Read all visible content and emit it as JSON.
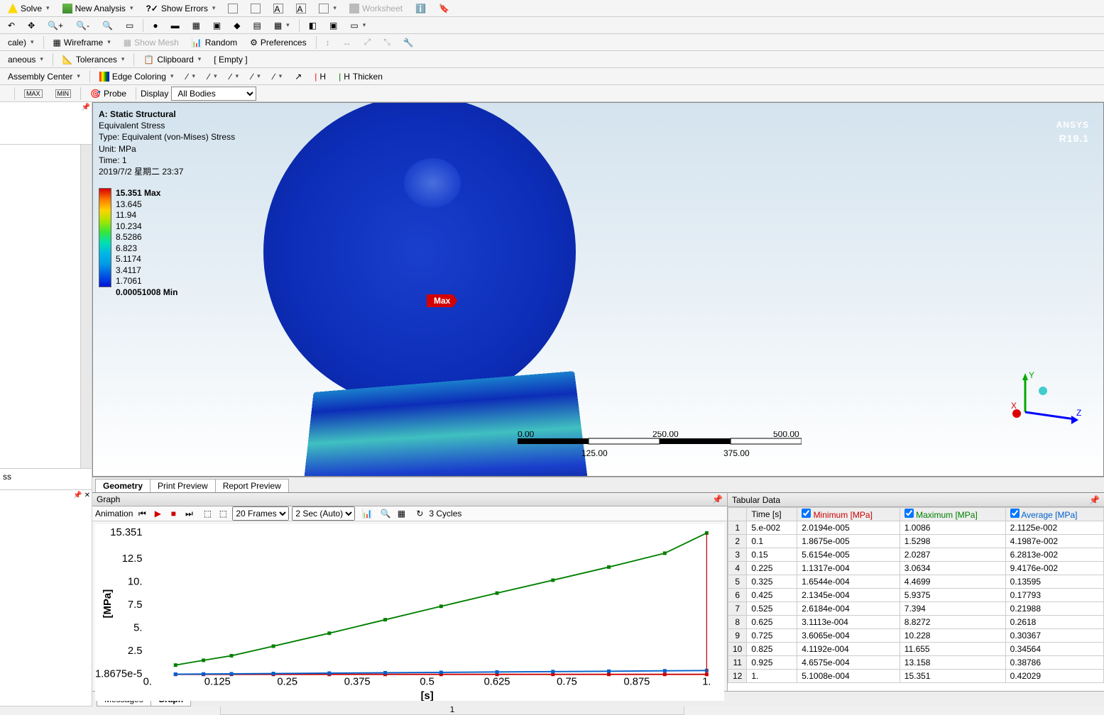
{
  "toolbars": {
    "row1": {
      "solve": "Solve",
      "new_analysis": "New Analysis",
      "show_errors": "Show Errors",
      "worksheet": "Worksheet"
    },
    "row2": {
      "scale": "cale)",
      "wireframe": "Wireframe",
      "show_mesh": "Show Mesh",
      "random": "Random",
      "preferences": "Preferences"
    },
    "row3": {
      "aneous": "aneous",
      "tolerances": "Tolerances",
      "clipboard": "Clipboard",
      "empty": "[ Empty ]"
    },
    "row4": {
      "assembly_center": "Assembly Center",
      "edge_coloring": "Edge Coloring",
      "thicken": "Thicken"
    },
    "row5": {
      "probe": "Probe",
      "display": "Display",
      "all_bodies": "All Bodies"
    }
  },
  "viewport": {
    "title": "A: Static Structural",
    "subtitle1": "Equivalent Stress",
    "subtitle2": "Type: Equivalent (von-Mises) Stress",
    "unit": "Unit: MPa",
    "time": "Time: 1",
    "timestamp": "2019/7/2 星期二 23:37",
    "legend": [
      "15.351 Max",
      "13.645",
      "11.94",
      "10.234",
      "8.5286",
      "6.823",
      "5.1174",
      "3.4117",
      "1.7061",
      "0.00051008 Min"
    ],
    "max_tag": "Max",
    "scale": {
      "v0": "0.00",
      "v1": "125.00",
      "v2": "250.00",
      "v3": "375.00",
      "v4": "500.00 (mm)"
    },
    "brand": "ANSYS",
    "version": "R19.1",
    "axes": {
      "x": "X",
      "y": "Y",
      "z": "Z"
    }
  },
  "view_tabs": {
    "geometry": "Geometry",
    "print": "Print Preview",
    "report": "Report Preview"
  },
  "graph_panel": {
    "title": "Graph",
    "animation": "Animation",
    "frames": "20 Frames",
    "duration": "2 Sec (Auto)",
    "cycles": "3 Cycles",
    "ylabel": "[MPa]",
    "xlabel": "[s]",
    "scrollpos": "1"
  },
  "tabular_panel": {
    "title": "Tabular Data",
    "headers": {
      "time": "Time [s]",
      "min": "Minimum [MPa]",
      "max": "Maximum [MPa]",
      "avg": "Average [MPa]"
    },
    "rows": [
      {
        "n": "1",
        "time": "5.e-002",
        "min": "2.0194e-005",
        "max": "1.0086",
        "avg": "2.1125e-002"
      },
      {
        "n": "2",
        "time": "0.1",
        "min": "1.8675e-005",
        "max": "1.5298",
        "avg": "4.1987e-002"
      },
      {
        "n": "3",
        "time": "0.15",
        "min": "5.6154e-005",
        "max": "2.0287",
        "avg": "6.2813e-002"
      },
      {
        "n": "4",
        "time": "0.225",
        "min": "1.1317e-004",
        "max": "3.0634",
        "avg": "9.4176e-002"
      },
      {
        "n": "5",
        "time": "0.325",
        "min": "1.6544e-004",
        "max": "4.4699",
        "avg": "0.13595"
      },
      {
        "n": "6",
        "time": "0.425",
        "min": "2.1345e-004",
        "max": "5.9375",
        "avg": "0.17793"
      },
      {
        "n": "7",
        "time": "0.525",
        "min": "2.6184e-004",
        "max": "7.394",
        "avg": "0.21988"
      },
      {
        "n": "8",
        "time": "0.625",
        "min": "3.1113e-004",
        "max": "8.8272",
        "avg": "0.2618"
      },
      {
        "n": "9",
        "time": "0.725",
        "min": "3.6065e-004",
        "max": "10.228",
        "avg": "0.30367"
      },
      {
        "n": "10",
        "time": "0.825",
        "min": "4.1192e-004",
        "max": "11.655",
        "avg": "0.34564"
      },
      {
        "n": "11",
        "time": "0.925",
        "min": "4.6575e-004",
        "max": "13.158",
        "avg": "0.38786"
      },
      {
        "n": "12",
        "time": "1.",
        "min": "5.1008e-004",
        "max": "15.351",
        "avg": "0.42029"
      }
    ]
  },
  "bottom_tabs": {
    "messages": "Messages",
    "graph": "Graph"
  },
  "chart_data": {
    "type": "line",
    "title": "",
    "xlabel": "[s]",
    "ylabel": "[MPa]",
    "xlim": [
      0,
      1
    ],
    "ylim": [
      1.8675e-05,
      15.351
    ],
    "x_ticks": [
      "0.",
      "0.125",
      "0.25",
      "0.375",
      "0.5",
      "0.625",
      "0.75",
      "0.875",
      "1."
    ],
    "y_ticks": [
      "1.8675e-5",
      "2.5",
      "5.",
      "7.5",
      "10.",
      "12.5",
      "15.351"
    ],
    "x": [
      0.05,
      0.1,
      0.15,
      0.225,
      0.325,
      0.425,
      0.525,
      0.625,
      0.725,
      0.825,
      0.925,
      1.0
    ],
    "series": [
      {
        "name": "Minimum",
        "color": "#cc0000",
        "values": [
          2.0194e-05,
          1.8675e-05,
          5.6154e-05,
          0.00011317,
          0.00016544,
          0.00021345,
          0.00026184,
          0.00031113,
          0.00036065,
          0.00041192,
          0.00046575,
          0.00051008
        ]
      },
      {
        "name": "Maximum",
        "color": "#008000",
        "values": [
          1.0086,
          1.5298,
          2.0287,
          3.0634,
          4.4699,
          5.9375,
          7.394,
          8.8272,
          10.228,
          11.655,
          13.158,
          15.351
        ]
      },
      {
        "name": "Average",
        "color": "#0060cc",
        "values": [
          0.021125,
          0.041987,
          0.062813,
          0.094176,
          0.13595,
          0.17793,
          0.21988,
          0.2618,
          0.30367,
          0.34564,
          0.38786,
          0.42029
        ]
      }
    ]
  }
}
